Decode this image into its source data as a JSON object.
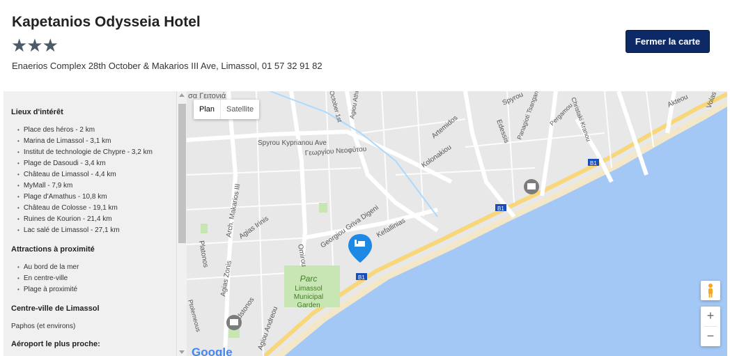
{
  "header": {
    "hotel_name": "Kapetanios Odysseia Hotel",
    "stars": "★★★",
    "address": "Enaerios Complex 28th October & Makarios III Ave,  Limassol,  01 57 32 91 82",
    "close_button": "Fermer la carte"
  },
  "sidebar": {
    "poi_title": "Lieux d'intérêt",
    "poi": [
      "Place des héros - 2 km",
      "Marina de Limassol - 3,1 km",
      "Institut de technologie de Chypre - 3,2 km",
      "Plage de Dasoudi - 3,4 km",
      "Château de Limassol - 4,4 km",
      "MyMall - 7,9 km",
      "Plage d'Amathus - 10,8 km",
      "Château de Colosse - 19,1 km",
      "Ruines de Kourion - 21,4 km",
      "Lac salé de Limassol - 27,1 km"
    ],
    "attractions_title": "Attractions à proximité",
    "attractions": [
      "Au bord de la mer",
      "En centre-ville",
      "Plage à proximité"
    ],
    "centre_title": "Centre-ville de Limassol",
    "centre_text": "Paphos (et environs)",
    "airport_title": "Aéroport le plus proche:"
  },
  "map": {
    "type_plan": "Plan",
    "type_satellite": "Satellite",
    "zoom_in": "+",
    "zoom_out": "−",
    "park_label_1": "Parc",
    "park_label_2": "Limassol",
    "park_label_3": "Municipal",
    "park_label_4": "Garden",
    "roads": {
      "kyprianou": "Spyrou Kyprianou Ave",
      "kyprianou_gr": "Γεωργίου Νεοφύτου",
      "griva": "Georgiou Griva Digeni",
      "kolonakiou": "Kolonakiou",
      "kefallinias": "Kefallinias",
      "makarios": "Arch. Makarios III",
      "omirou": "Omirou",
      "agias_irinis": "Agias Irinis",
      "platonos": "Platonos",
      "agias_zonis": "Agias Zonis",
      "gladstonos": "Gladstonos",
      "agiou_andreou": "Agiou Andreou",
      "artemidos": "Artemidos",
      "edessis": "Edessis",
      "tsangari": "Panagioti Tsangari",
      "pergamou": "Pergamou",
      "kranou": "Christaki Kranou",
      "spyrou": "Spyrou",
      "akteou": "Akteou",
      "volas": "Volas",
      "october": "October 1st",
      "athinon": "Agiou Athin",
      "geitonia": "σα Γειτονιά",
      "sealiko": "Ptolemeous",
      "b1": "B1"
    },
    "google": "Google"
  }
}
